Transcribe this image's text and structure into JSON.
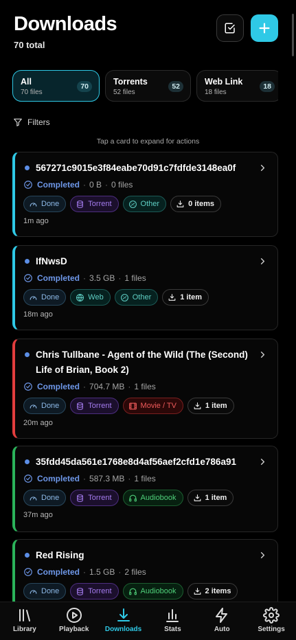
{
  "header": {
    "title": "Downloads",
    "subtitle": "70 total"
  },
  "segments": [
    {
      "name": "All",
      "sub": "70 files",
      "count": "70",
      "active": true
    },
    {
      "name": "Torrents",
      "sub": "52 files",
      "count": "52",
      "active": false
    },
    {
      "name": "Web Link",
      "sub": "18 files",
      "count": "18",
      "active": false
    }
  ],
  "filters_label": "Filters",
  "hint": "Tap a card to expand for actions",
  "cards": [
    {
      "title": "567271c9015e3f84eabe70d91c7fdfde3148ea0f",
      "status": "Completed",
      "size": "0 B",
      "files": "0 files",
      "chips": [
        {
          "icon": "gauge-icon",
          "label": "Done",
          "kind": "done"
        },
        {
          "icon": "database-icon",
          "label": "Torrent",
          "kind": "torrent"
        },
        {
          "icon": "other-icon",
          "label": "Other",
          "kind": "other"
        },
        {
          "icon": "download-tray-icon",
          "label": "0 items",
          "kind": "items"
        }
      ],
      "time": "1m ago",
      "accent": "#2fc9e6"
    },
    {
      "title": "IfNwsD",
      "status": "Completed",
      "size": "3.5 GB",
      "files": "1 files",
      "chips": [
        {
          "icon": "gauge-icon",
          "label": "Done",
          "kind": "done"
        },
        {
          "icon": "globe-icon",
          "label": "Web",
          "kind": "web"
        },
        {
          "icon": "other-icon",
          "label": "Other",
          "kind": "other"
        },
        {
          "icon": "download-tray-icon",
          "label": "1 item",
          "kind": "items"
        }
      ],
      "time": "18m ago",
      "accent": "#2fc9e6"
    },
    {
      "title": "Chris Tullbane - Agent of the Wild (The (Second) Life of Brian, Book 2)",
      "status": "Completed",
      "size": "704.7 MB",
      "files": "1 files",
      "chips": [
        {
          "icon": "gauge-icon",
          "label": "Done",
          "kind": "done"
        },
        {
          "icon": "database-icon",
          "label": "Torrent",
          "kind": "torrent"
        },
        {
          "icon": "film-icon",
          "label": "Movie / TV",
          "kind": "movie"
        },
        {
          "icon": "download-tray-icon",
          "label": "1 item",
          "kind": "items"
        }
      ],
      "time": "20m ago",
      "accent": "#e23d3d"
    },
    {
      "title": "35fdd45da561e1768e8d4af56aef2cfd1e786a91",
      "status": "Completed",
      "size": "587.3 MB",
      "files": "1 files",
      "chips": [
        {
          "icon": "gauge-icon",
          "label": "Done",
          "kind": "done"
        },
        {
          "icon": "database-icon",
          "label": "Torrent",
          "kind": "torrent"
        },
        {
          "icon": "headphones-icon",
          "label": "Audiobook",
          "kind": "audio"
        },
        {
          "icon": "download-tray-icon",
          "label": "1 item",
          "kind": "items"
        }
      ],
      "time": "37m ago",
      "accent": "#2bb35a"
    },
    {
      "title": "Red Rising",
      "status": "Completed",
      "size": "1.5 GB",
      "files": "2 files",
      "chips": [
        {
          "icon": "gauge-icon",
          "label": "Done",
          "kind": "done"
        },
        {
          "icon": "database-icon",
          "label": "Torrent",
          "kind": "torrent"
        },
        {
          "icon": "headphones-icon",
          "label": "Audiobook",
          "kind": "audio"
        },
        {
          "icon": "download-tray-icon",
          "label": "2 items",
          "kind": "items"
        }
      ],
      "time": "",
      "accent": "#2bb35a"
    }
  ],
  "nav": [
    {
      "icon": "library-icon",
      "label": "Library",
      "active": false
    },
    {
      "icon": "play-circle-icon",
      "label": "Playback",
      "active": false
    },
    {
      "icon": "download-icon",
      "label": "Downloads",
      "active": true
    },
    {
      "icon": "bar-chart-icon",
      "label": "Stats",
      "active": false
    },
    {
      "icon": "lightning-icon",
      "label": "Auto",
      "active": false
    },
    {
      "icon": "gear-icon",
      "label": "Settings",
      "active": false
    }
  ],
  "colors": {
    "accent": "#2fc9e6",
    "status_blue": "#6e97e8",
    "red": "#e23d3d",
    "green": "#2bb35a"
  }
}
